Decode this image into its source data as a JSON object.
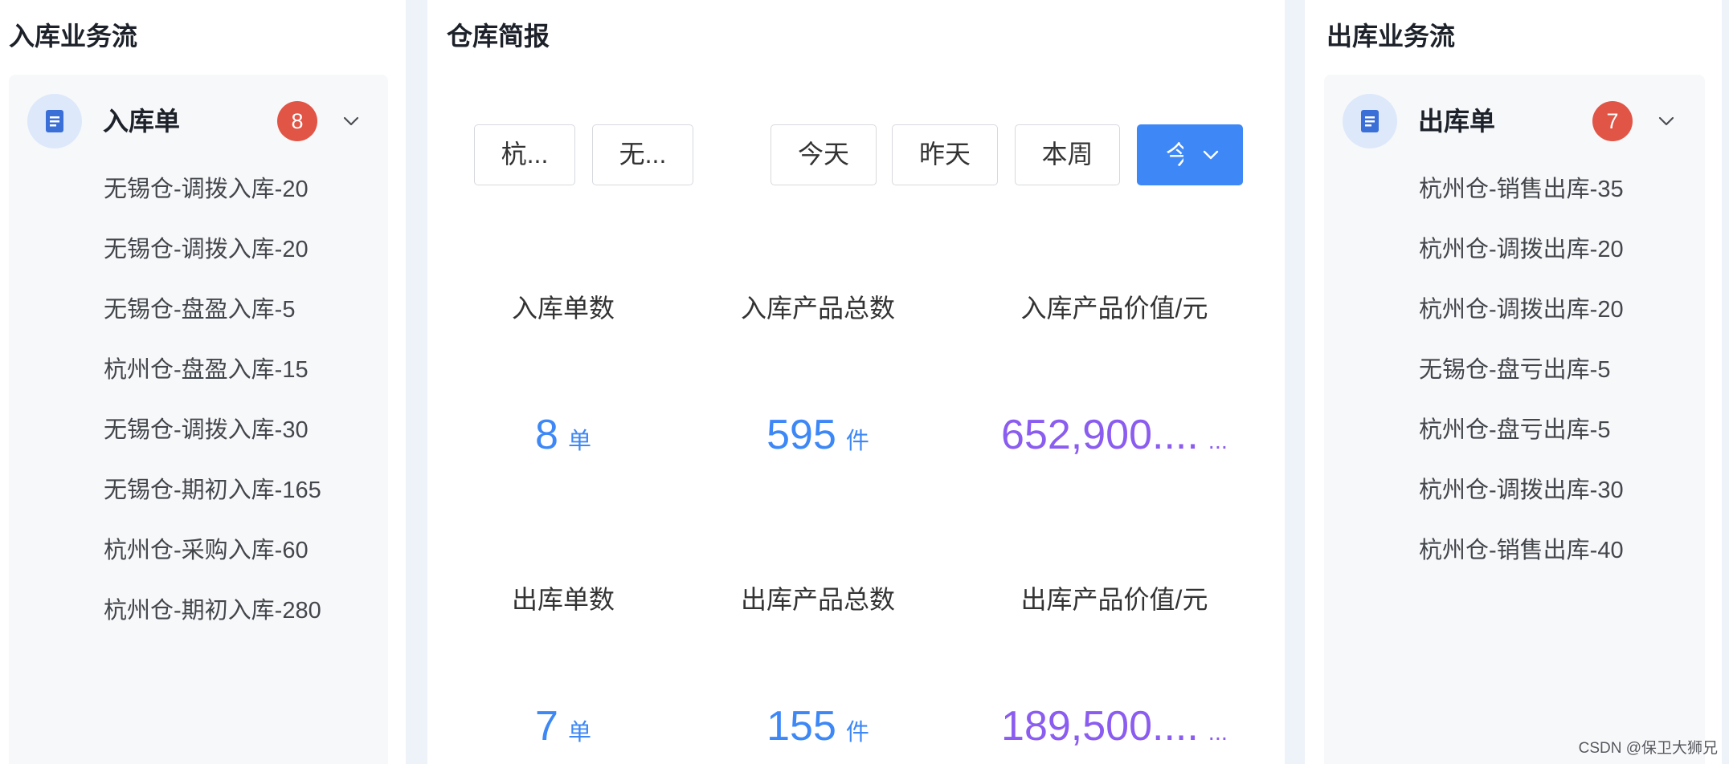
{
  "colors": {
    "page_bg": "#eef2f9",
    "panel_bg": "#ffffff",
    "card_bg": "#f7f8fa",
    "accent_blue": "#3d88f6",
    "value_purple": "#8b5cf0",
    "badge_red": "#e05546",
    "icon_bg": "#dde8fa",
    "icon_blue": "#3b6fd8"
  },
  "inbound": {
    "title": "入库业务流",
    "group": {
      "icon": "document-icon",
      "label": "入库单",
      "badge": "8",
      "toggle_icon": "chevron-down-icon"
    },
    "items": [
      "无锡仓-调拨入库-20",
      "无锡仓-调拨入库-20",
      "无锡仓-盘盈入库-5",
      "杭州仓-盘盈入库-15",
      "无锡仓-调拨入库-30",
      "无锡仓-期初入库-165",
      "杭州仓-采购入库-60",
      "杭州仓-期初入库-280"
    ]
  },
  "summary": {
    "title": "仓库简报",
    "warehouse_filters": [
      "杭...",
      "无..."
    ],
    "date_filters": [
      "今天",
      "昨天",
      "本周"
    ],
    "date_select": {
      "value": "今",
      "icon": "chevron-down-icon"
    },
    "stats": [
      {
        "label": "入库单数",
        "value": "8",
        "unit": "单"
      },
      {
        "label": "入库产品总数",
        "value": "595",
        "unit": "件"
      },
      {
        "label": "入库产品价值/元",
        "value": "652,900....",
        "unit": "..."
      },
      {
        "label": "出库单数",
        "value": "7",
        "unit": "单"
      },
      {
        "label": "出库产品总数",
        "value": "155",
        "unit": "件"
      },
      {
        "label": "出库产品价值/元",
        "value": "189,500....",
        "unit": "..."
      }
    ]
  },
  "outbound": {
    "title": "出库业务流",
    "group": {
      "icon": "document-icon",
      "label": "出库单",
      "badge": "7",
      "toggle_icon": "chevron-down-icon"
    },
    "items": [
      "杭州仓-销售出库-35",
      "杭州仓-调拨出库-20",
      "杭州仓-调拨出库-20",
      "无锡仓-盘亏出库-5",
      "杭州仓-盘亏出库-5",
      "杭州仓-调拨出库-30",
      "杭州仓-销售出库-40"
    ]
  },
  "watermark": "CSDN @保卫大狮兄"
}
